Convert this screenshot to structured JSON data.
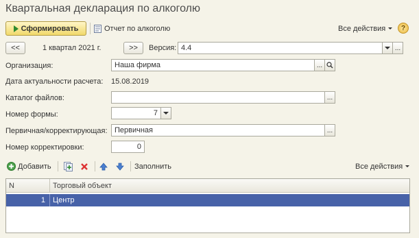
{
  "title": "Квартальная декларация по алкоголю",
  "toolbar": {
    "generate_label": "Сформировать",
    "report_label": "Отчет по алкоголю",
    "all_actions_label": "Все действия",
    "help_label": "?"
  },
  "period": {
    "prev_label": "<<",
    "value": "1 квартал 2021 г.",
    "next_label": ">>",
    "version_label": "Версия:",
    "version_value": "4.4",
    "more_label": "..."
  },
  "form": {
    "organization_label": "Организация:",
    "organization_value": "Наша фирма",
    "actual_date_label": "Дата актуальности расчета:",
    "actual_date_value": "15.08.2019",
    "catalog_label": "Каталог файлов:",
    "catalog_value": "",
    "form_number_label": "Номер формы:",
    "form_number_value": "7",
    "primary_label": "Первичная/корректирующая:",
    "primary_value": "Первичная",
    "correction_label": "Номер корректировки:",
    "correction_value": "0",
    "more_label": "..."
  },
  "table_toolbar": {
    "add_label": "Добавить",
    "fill_label": "Заполнить",
    "all_actions_label": "Все действия"
  },
  "table": {
    "columns": [
      "N",
      "Торговый объект"
    ],
    "rows": [
      {
        "n": "1",
        "object": "Центр"
      }
    ]
  },
  "colors": {
    "background": "#f5f3e8",
    "selection": "#4762a8",
    "primary_button": "#f1d96b"
  }
}
